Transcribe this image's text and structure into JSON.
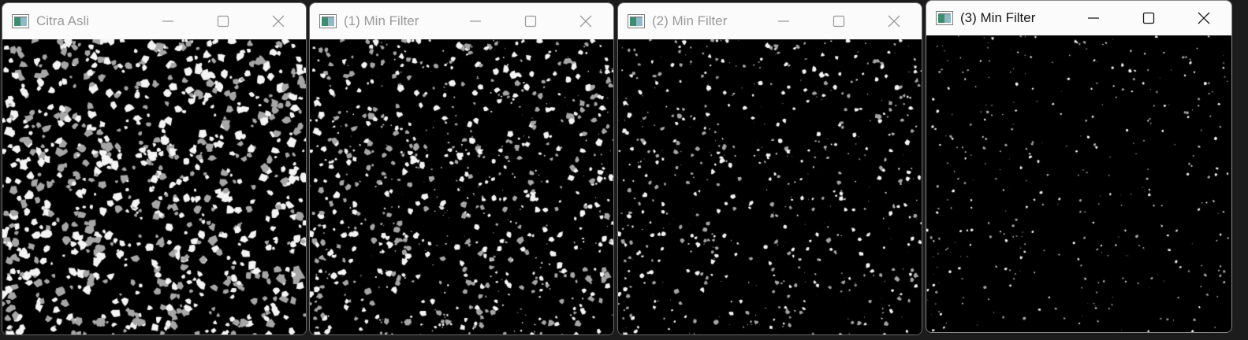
{
  "windows": [
    {
      "title": "Citra Asli",
      "active": false
    },
    {
      "title": "(1) Min Filter",
      "active": false
    },
    {
      "title": "(2) Min Filter",
      "active": false
    },
    {
      "title": "(3) Min Filter",
      "active": true
    }
  ],
  "colors": {
    "titlebar": "#fbfbfb",
    "inactive_title": "#9a9a9a",
    "active_title": "#1a1a1a",
    "image_background": "#000000",
    "particle_white": "#f4f4f4",
    "particle_gray": "#a6a6a6"
  },
  "icons": {
    "app": "image-window-icon",
    "minimize": "minimize-icon",
    "maximize": "maximize-icon",
    "close": "close-icon"
  }
}
